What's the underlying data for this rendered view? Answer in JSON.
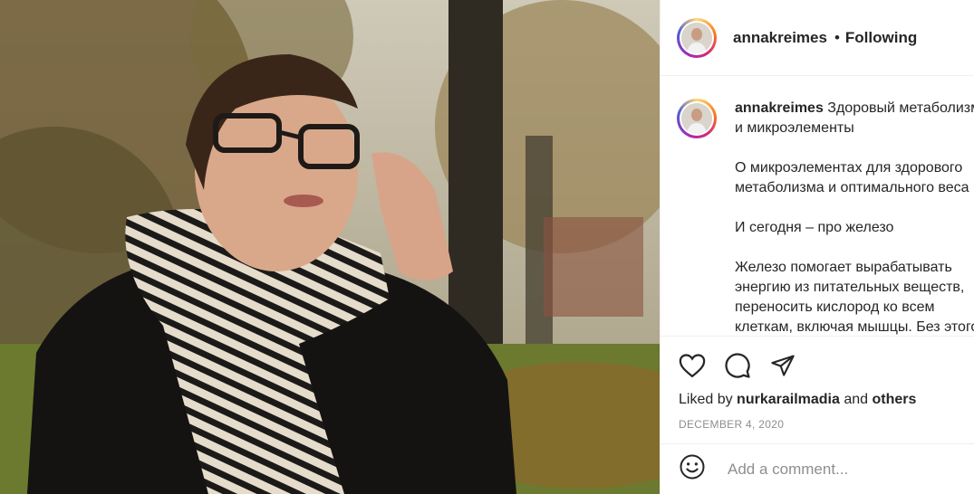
{
  "header": {
    "username": "annakreimes",
    "separator": "•",
    "follow_status": "Following"
  },
  "caption": {
    "username": "annakreimes",
    "lines": [
      "Здоровый метаболизм",
      "и микроэлементы",
      "О микроэлементах для здорового",
      "метаболизма и оптимального веса",
      "И сегодня – про железо",
      "Железо помогает вырабатывать",
      "энергию из питательных веществ,",
      "переносить кислород ко всем",
      "клеткам, включая мышцы. Без этого"
    ]
  },
  "actions": {
    "icons": [
      "heart-icon",
      "comment-icon",
      "share-icon"
    ],
    "liked_by_prefix": "Liked by",
    "liked_by_user": "nurkarailmadia",
    "liked_by_and": "and",
    "liked_by_others": "others",
    "date": "DECEMBER 4, 2020"
  },
  "comment": {
    "placeholder": "Add a comment...",
    "emoji_icon": "emoji-icon"
  },
  "colors": {
    "text": "#262626",
    "muted": "#8e8e8e",
    "divider": "#efefef"
  }
}
